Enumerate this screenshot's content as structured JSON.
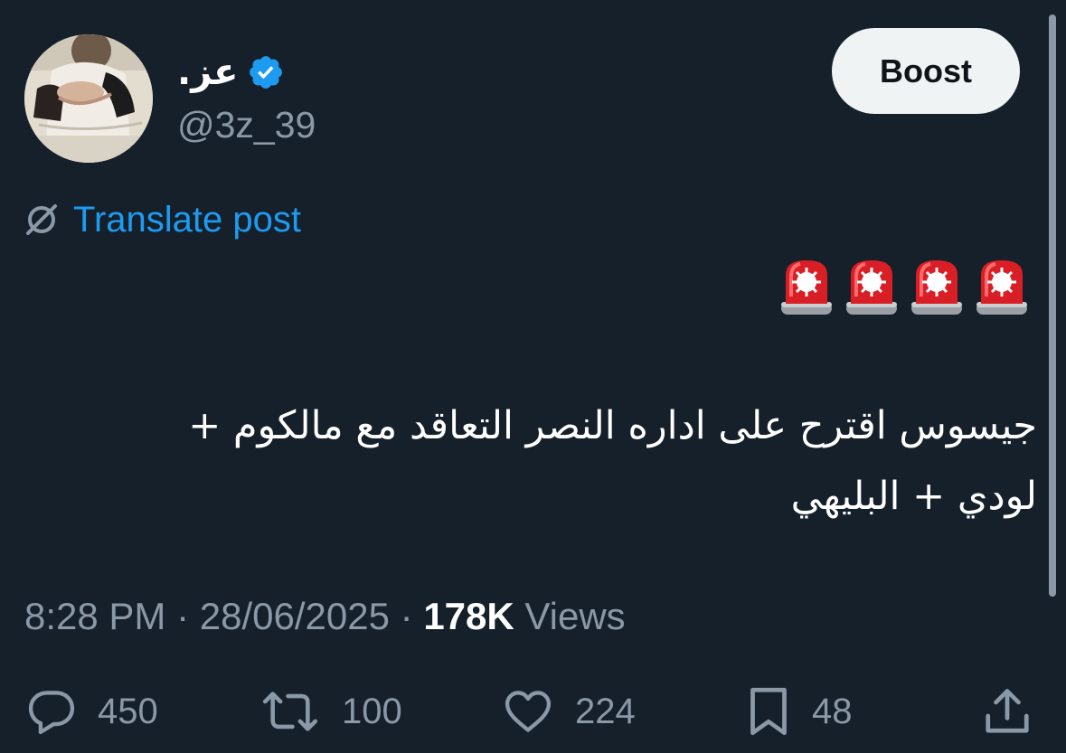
{
  "post": {
    "author": {
      "display_name": "عز.",
      "handle": "@3z_39",
      "verified_color": "#1d9bf0"
    },
    "boost_label": "Boost",
    "translate_label": "Translate post",
    "emoji_line": [
      "🚨",
      "🚨",
      "🚨",
      "🚨"
    ],
    "text": "جيسوس اقترح على اداره النصر التعاقد مع مالكوم +\nلودي + البليهي",
    "time": "8:28 PM",
    "separator": "·",
    "date": "28/06/2025",
    "views_count": "178K",
    "views_label": "Views",
    "actions": {
      "replies": "450",
      "reposts": "100",
      "likes": "224",
      "bookmarks": "48"
    }
  },
  "colors": {
    "background": "#15202b",
    "accent": "#1d9bf0",
    "muted": "#8b98a5",
    "text": "#ffffff",
    "button_bg": "#eff3f4"
  },
  "icons": [
    "verified-badge-icon",
    "translate-icon",
    "siren-emoji",
    "reply-icon",
    "repost-icon",
    "like-icon",
    "bookmark-icon",
    "share-icon"
  ]
}
